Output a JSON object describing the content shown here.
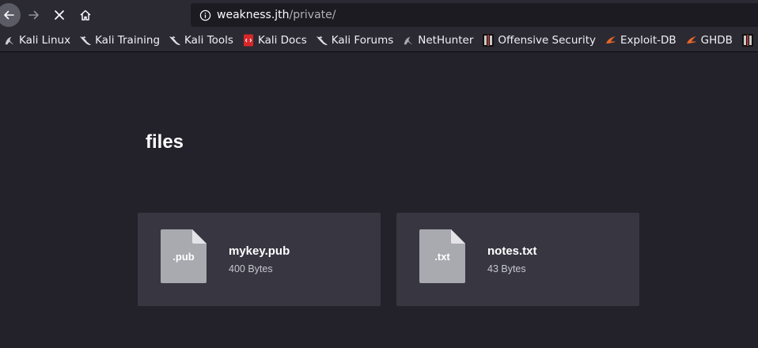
{
  "browser": {
    "url_host": "weakness.jth",
    "url_path": "/private/",
    "nav_icons": [
      "back-arrow-icon",
      "forward-arrow-icon",
      "stop-icon",
      "home-icon"
    ]
  },
  "bookmarks": [
    {
      "label": "Kali Linux",
      "icon": "kali-dragon-icon"
    },
    {
      "label": "Kali Training",
      "icon": "kali-dragon-icon"
    },
    {
      "label": "Kali Tools",
      "icon": "kali-dragon-icon"
    },
    {
      "label": "Kali Docs",
      "icon": "kali-docs-icon"
    },
    {
      "label": "Kali Forums",
      "icon": "kali-dragon-icon"
    },
    {
      "label": "NetHunter",
      "icon": "nethunter-icon"
    },
    {
      "label": "Offensive Security",
      "icon": "offsec-icon"
    },
    {
      "label": "Exploit-DB",
      "icon": "exploit-db-icon"
    },
    {
      "label": "GHDB",
      "icon": "ghdb-icon"
    }
  ],
  "page": {
    "title": "files",
    "files": [
      {
        "ext": ".pub",
        "name": "mykey.pub",
        "size": "400 Bytes"
      },
      {
        "ext": ".txt",
        "name": "notes.txt",
        "size": "43 Bytes"
      }
    ]
  },
  "colors": {
    "page_background": "#23222b",
    "card_background": "#373641",
    "file_icon": "#a9a9b0",
    "toolbar": "#2b2a33"
  }
}
